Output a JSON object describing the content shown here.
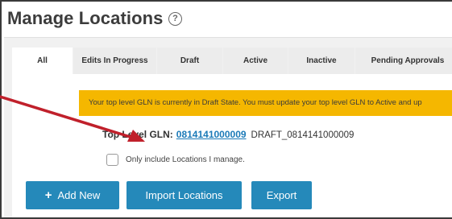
{
  "header": {
    "title": "Manage Locations",
    "help_icon": "help-circle-icon"
  },
  "tabs": [
    {
      "label": "All",
      "active": true
    },
    {
      "label": "Edits In Progress",
      "active": false
    },
    {
      "label": "Draft",
      "active": false
    },
    {
      "label": "Active",
      "active": false
    },
    {
      "label": "Inactive",
      "active": false
    },
    {
      "label": "Pending Approvals",
      "active": false
    }
  ],
  "alert": {
    "text": "Your top level GLN is currently in Draft State. You must update your top level GLN to Active and up"
  },
  "gln": {
    "label": "Top Level GLN:",
    "value": "0814141000009",
    "draft_value": "DRAFT_0814141000009"
  },
  "filter": {
    "only_mine_label": "Only include Locations I manage.",
    "checked": false
  },
  "buttons": {
    "add_new": "Add New",
    "add_icon": "plus-icon",
    "import": "Import Locations",
    "export": "Export"
  },
  "colors": {
    "primary_button": "#2589ba",
    "alert_bg": "#f5b700",
    "link": "#1b7ab8",
    "annotation_arrow": "#c0202b"
  }
}
